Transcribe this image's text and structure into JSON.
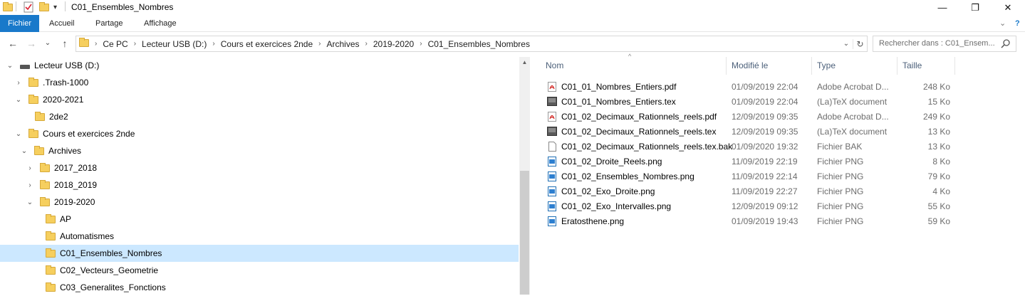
{
  "window": {
    "title": "C01_Ensembles_Nombres",
    "minimize_glyph": "—",
    "maximize_glyph": "❐",
    "close_glyph": "✕"
  },
  "ribbon": {
    "tabs": [
      "Fichier",
      "Accueil",
      "Partage",
      "Affichage"
    ],
    "help_glyph": "?"
  },
  "nav": {
    "back": "←",
    "forward": "→",
    "recent": "⌄",
    "up": "↑"
  },
  "address": {
    "crumbs": [
      "Ce PC",
      "Lecteur USB (D:)",
      "Cours et exercices 2nde",
      "Archives",
      "2019-2020",
      "C01_Ensembles_Nombres"
    ],
    "dropdown_glyph": "⌄",
    "refresh_glyph": "↻"
  },
  "search": {
    "placeholder": "Rechercher dans : C01_Ensem..."
  },
  "tree": {
    "items": [
      {
        "label": "Lecteur USB (D:)",
        "twisty": "⌄",
        "icon": "usb-drive-icon"
      },
      {
        "label": ".Trash-1000",
        "twisty": "›",
        "icon": "folder-icon"
      },
      {
        "label": "2020-2021",
        "twisty": "⌄",
        "icon": "folder-icon"
      },
      {
        "label": "2de2",
        "twisty": "",
        "icon": "folder-icon"
      },
      {
        "label": "Cours et exercices 2nde",
        "twisty": "⌄",
        "icon": "folder-icon"
      },
      {
        "label": "Archives",
        "twisty": "⌄",
        "icon": "folder-icon"
      },
      {
        "label": "2017_2018",
        "twisty": "›",
        "icon": "folder-icon"
      },
      {
        "label": "2018_2019",
        "twisty": "›",
        "icon": "folder-icon"
      },
      {
        "label": "2019-2020",
        "twisty": "⌄",
        "icon": "folder-icon"
      },
      {
        "label": "AP",
        "twisty": "",
        "icon": "folder-icon"
      },
      {
        "label": "Automatismes",
        "twisty": "",
        "icon": "folder-icon"
      },
      {
        "label": "C01_Ensembles_Nombres",
        "twisty": "",
        "icon": "folder-icon",
        "selected": true
      },
      {
        "label": "C02_Vecteurs_Geometrie",
        "twisty": "",
        "icon": "folder-icon"
      },
      {
        "label": "C03_Generalites_Fonctions",
        "twisty": "",
        "icon": "folder-icon"
      }
    ]
  },
  "columns": {
    "name": "Nom",
    "modified": "Modifié le",
    "type": "Type",
    "size": "Taille",
    "sort_glyph": "^"
  },
  "files": [
    {
      "name": "C01_01_Nombres_Entiers.pdf",
      "date": "01/09/2019 22:04",
      "type": "Adobe Acrobat D...",
      "size": "248 Ko",
      "icon": "pdf-icon"
    },
    {
      "name": "C01_01_Nombres_Entiers.tex",
      "date": "01/09/2019 22:04",
      "type": "(La)TeX document",
      "size": "15 Ko",
      "icon": "tex-icon"
    },
    {
      "name": "C01_02_Decimaux_Rationnels_reels.pdf",
      "date": "12/09/2019 09:35",
      "type": "Adobe Acrobat D...",
      "size": "249 Ko",
      "icon": "pdf-icon"
    },
    {
      "name": "C01_02_Decimaux_Rationnels_reels.tex",
      "date": "12/09/2019 09:35",
      "type": "(La)TeX document",
      "size": "13 Ko",
      "icon": "tex-icon"
    },
    {
      "name": "C01_02_Decimaux_Rationnels_reels.tex.bak",
      "date": "01/09/2020 19:32",
      "type": "Fichier BAK",
      "size": "13 Ko",
      "icon": "blank-file-icon"
    },
    {
      "name": "C01_02_Droite_Reels.png",
      "date": "11/09/2019 22:19",
      "type": "Fichier PNG",
      "size": "8 Ko",
      "icon": "image-icon"
    },
    {
      "name": "C01_02_Ensembles_Nombres.png",
      "date": "11/09/2019 22:14",
      "type": "Fichier PNG",
      "size": "79 Ko",
      "icon": "image-icon"
    },
    {
      "name": "C01_02_Exo_Droite.png",
      "date": "11/09/2019 22:27",
      "type": "Fichier PNG",
      "size": "4 Ko",
      "icon": "image-icon"
    },
    {
      "name": "C01_02_Exo_Intervalles.png",
      "date": "12/09/2019 09:12",
      "type": "Fichier PNG",
      "size": "55 Ko",
      "icon": "image-icon"
    },
    {
      "name": "Eratosthene.png",
      "date": "01/09/2019 19:43",
      "type": "Fichier PNG",
      "size": "59 Ko",
      "icon": "image-icon"
    }
  ],
  "colors": {
    "accent": "#1979ca",
    "selection": "#cce8ff",
    "folder": "#f6cf5e"
  }
}
